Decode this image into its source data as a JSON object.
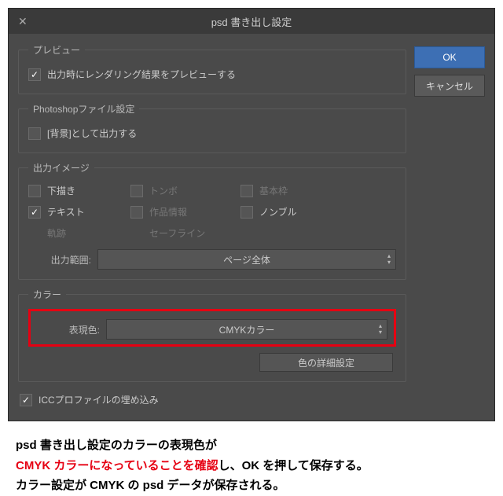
{
  "dialog": {
    "title": "psd 書き出し設定"
  },
  "buttons": {
    "ok": "OK",
    "cancel": "キャンセル"
  },
  "preview": {
    "legend": "プレビュー",
    "render_label": "出力時にレンダリング結果をプレビューする"
  },
  "ps_file": {
    "legend": "Photoshopファイル設定",
    "bg_label": "[背景]として出力する"
  },
  "output_image": {
    "legend": "出力イメージ",
    "items": {
      "draft": "下描き",
      "tombo": "トンボ",
      "basic_frame": "基本枠",
      "text": "テキスト",
      "work_info": "作品情報",
      "nombre": "ノンブル",
      "track": "軌跡",
      "safeline": "セーフライン"
    },
    "range_label": "出力範囲:",
    "range_value": "ページ全体"
  },
  "color": {
    "legend": "カラー",
    "express_label": "表現色:",
    "express_value": "CMYKカラー",
    "detail_btn": "色の詳細設定"
  },
  "icc": {
    "label": "ICCプロファイルの埋め込み"
  },
  "caption": {
    "line1": "psd 書き出し設定のカラーの表現色が",
    "line2_red": "CMYK カラーになっていることを確認",
    "line2_rest": "し、OK を押して保存する。",
    "line3": "カラー設定が CMYK の psd データが保存される。"
  }
}
